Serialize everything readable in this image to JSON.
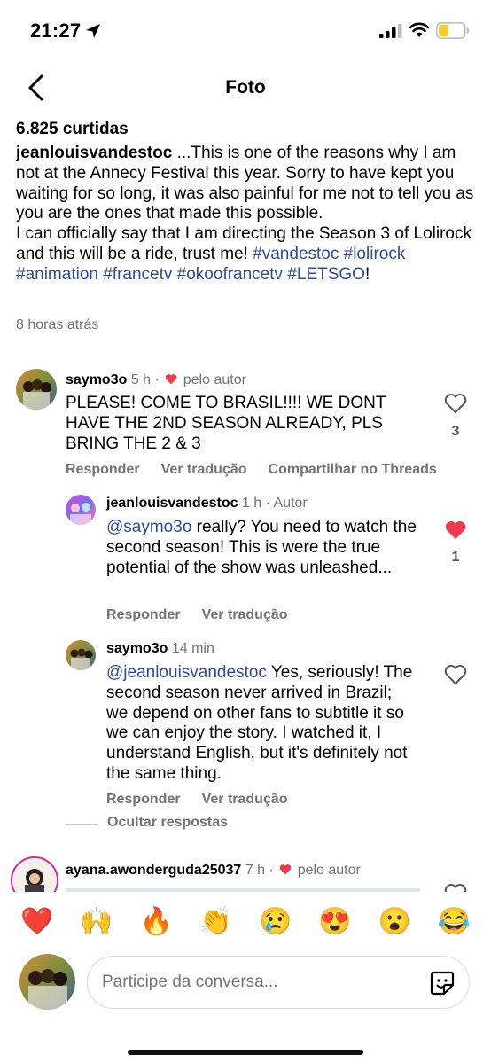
{
  "status_bar": {
    "time": "21:27",
    "icons": [
      "location-arrow-icon",
      "cellular-signal-icon",
      "wifi-icon",
      "battery-icon"
    ],
    "battery_color": "#f4cc2f"
  },
  "header": {
    "title": "Foto",
    "back_icon": "chevron-left-icon"
  },
  "post": {
    "likes": "6.825 curtidas",
    "username": "jeanlouisvandestoc",
    "caption_parts": [
      " ...This is one of the reasons why I am not at the Annecy Festival this year. Sorry to have kept you waiting for so long, it was also painful for me not to tell you as you are the ones that made this possible.",
      "I can officially say that I am directing the Season 3 of Lolirock and this will be a ride, trust me! "
    ],
    "hashtags": [
      "#vandestoc",
      "#lolirock",
      "#animation",
      "#francetv",
      "#okoofrancetv",
      "#LETSGO"
    ],
    "caption_end": "!",
    "time": "8 horas atrás"
  },
  "comments": [
    {
      "username": "saymo3o",
      "meta": "5 h ·",
      "badge": "pelo autor",
      "text": "PLEASE! COME TO BRASIL!!!! WE DONT HAVE THE 2ND SEASON ALREADY, PLS BRING THE 2 & 3",
      "likes": "3",
      "actions": [
        "Responder",
        "Ver tradução",
        "Compartilhar no Threads"
      ]
    },
    {
      "username": "jeanlouisvandestoc",
      "meta": "1 h · Autor",
      "mention": "@saymo3o",
      "text": " really? You need to watch the second season! This is were the true potential of the show was unleashed...",
      "likes": "1",
      "liked": true,
      "actions": [
        "Responder",
        "Ver tradução"
      ]
    },
    {
      "username": "saymo3o",
      "meta": "14 min",
      "mention": "@jeanlouisvandestoc",
      "text": " Yes, seriously! The second season never arrived in Brazil; we depend on other fans to subtitle it so we can enjoy the story. I watched it, I understand English, but it's definitely not the same thing.",
      "actions": [
        "Responder",
        "Ver tradução"
      ]
    },
    {
      "username": "ayana.awonderguda25037",
      "meta": "7 h ·",
      "badge": "pelo autor"
    }
  ],
  "hide_replies": "Ocultar respostas",
  "reactions": [
    "❤️",
    "🙌",
    "🔥",
    "👏",
    "😢",
    "😍",
    "😮",
    "😂"
  ],
  "composer": {
    "placeholder": "Participe da conversa...",
    "sticker_icon": "sticker-icon"
  },
  "colors": {
    "link": "#2e4a9e",
    "muted": "#737373",
    "heart_red": "#ed3b4b"
  }
}
